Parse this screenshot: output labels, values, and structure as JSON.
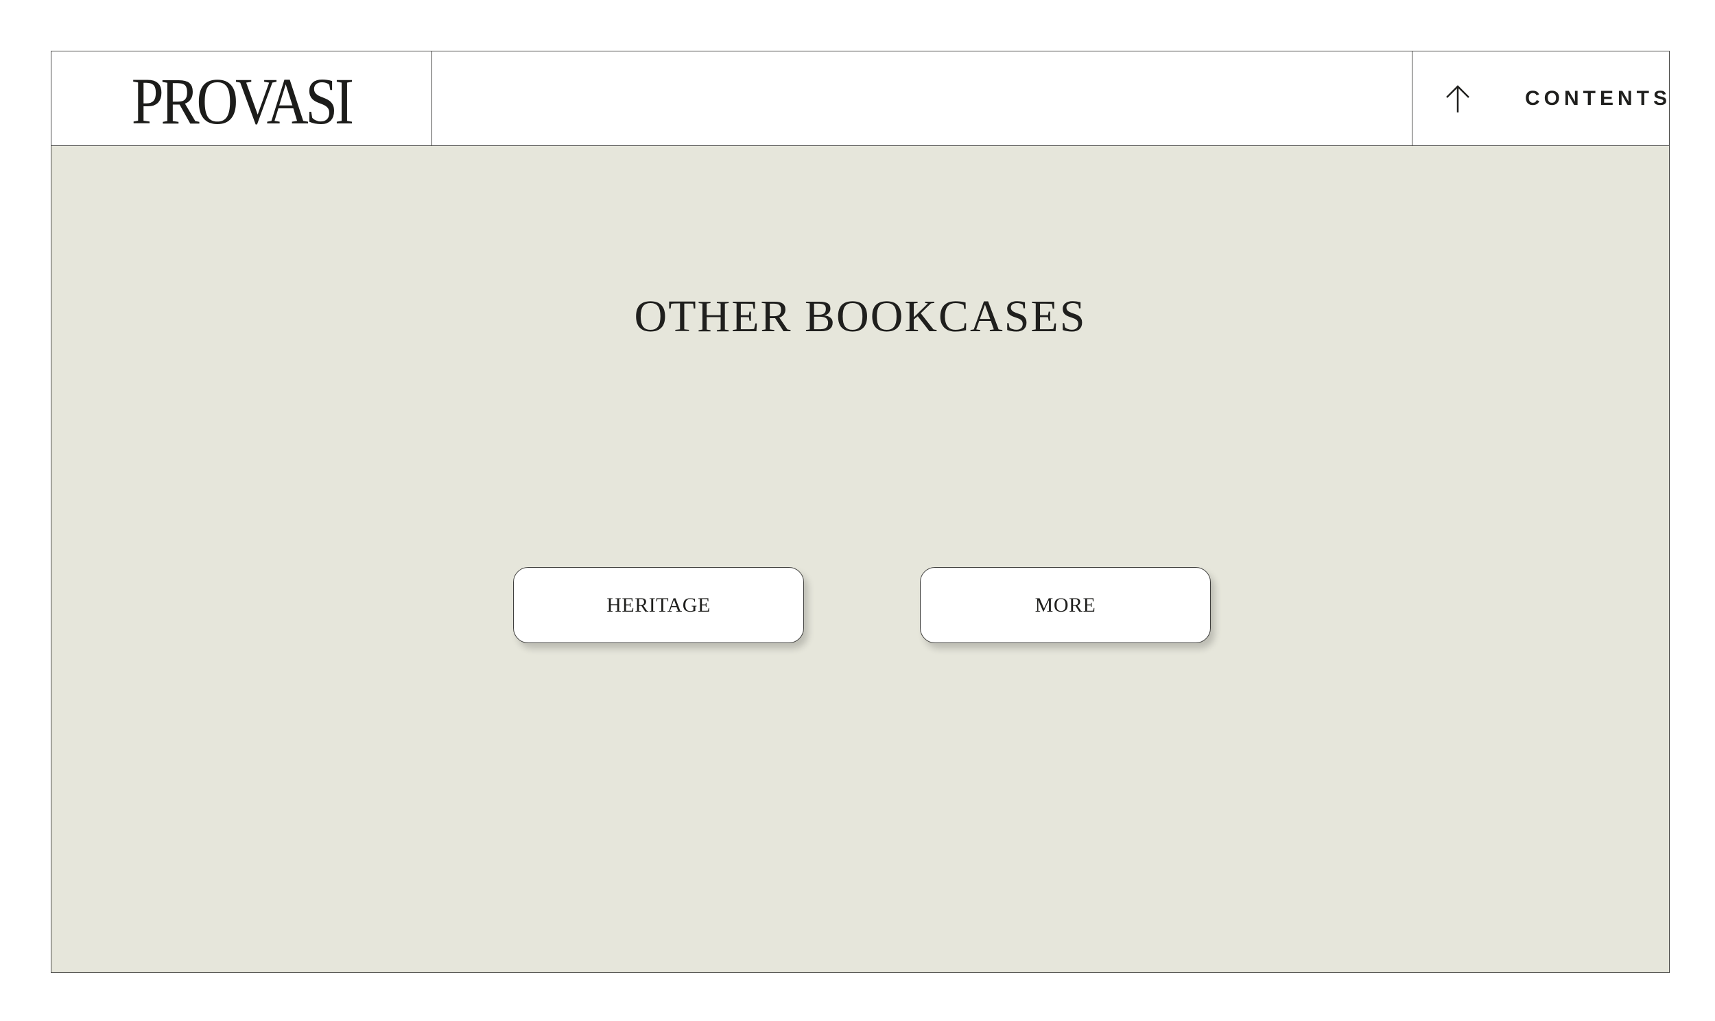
{
  "header": {
    "logo": "PROVASI",
    "contents_label": "CONTENTS",
    "contents_icon": "arrow-up-icon"
  },
  "main": {
    "title": "OTHER BOOKCASES",
    "buttons": [
      {
        "label": "HERITAGE"
      },
      {
        "label": "MORE"
      }
    ]
  },
  "colors": {
    "background": "#e6e6db",
    "header_background": "#ffffff",
    "border": "#4a4a48",
    "text": "#1f1f1d",
    "button_background": "#ffffff"
  }
}
